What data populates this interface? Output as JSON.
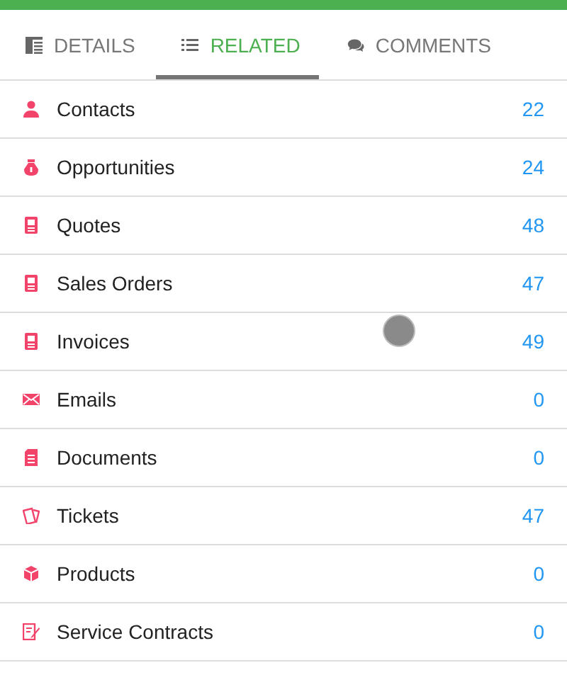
{
  "tabs": [
    {
      "label": "DETAILS",
      "kind": "details",
      "selected": false
    },
    {
      "label": "RELATED",
      "kind": "list",
      "selected": true
    },
    {
      "label": "COMMENTS",
      "kind": "comments",
      "selected": false
    }
  ],
  "related": [
    {
      "label": "Contacts",
      "count": "22",
      "kind": "person"
    },
    {
      "label": "Opportunities",
      "count": "24",
      "kind": "moneybag"
    },
    {
      "label": "Quotes",
      "count": "48",
      "kind": "quote"
    },
    {
      "label": "Sales Orders",
      "count": "47",
      "kind": "order"
    },
    {
      "label": "Invoices",
      "count": "49",
      "kind": "invoice"
    },
    {
      "label": "Emails",
      "count": "0",
      "kind": "mail"
    },
    {
      "label": "Documents",
      "count": "0",
      "kind": "document"
    },
    {
      "label": "Tickets",
      "count": "47",
      "kind": "ticket"
    },
    {
      "label": "Products",
      "count": "0",
      "kind": "product"
    },
    {
      "label": "Service Contracts",
      "count": "0",
      "kind": "contract"
    }
  ]
}
